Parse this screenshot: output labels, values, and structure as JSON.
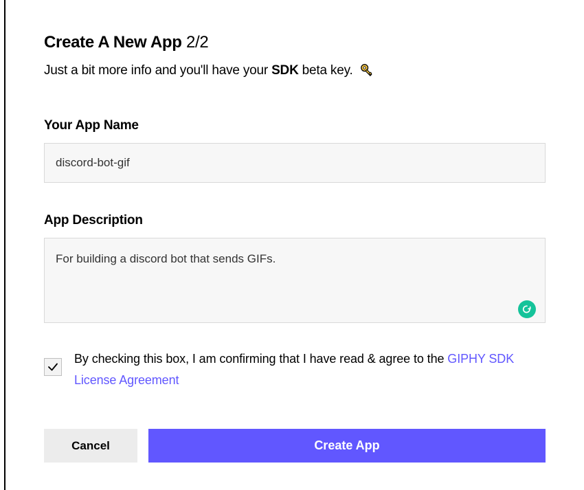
{
  "header": {
    "title_bold": "Create A New App",
    "step": "2/2",
    "subtitle_pre": "Just a bit more info and you'll have your ",
    "subtitle_bold": "SDK",
    "subtitle_post": " beta key."
  },
  "fields": {
    "app_name": {
      "label": "Your App Name",
      "value": "discord-bot-gif"
    },
    "app_description": {
      "label": "App Description",
      "value": "For building a discord bot that sends GIFs."
    }
  },
  "consent": {
    "checked": true,
    "text": "By checking this box, I am confirming that I have read & agree to the ",
    "link_text": "GIPHY SDK License Agreement"
  },
  "buttons": {
    "cancel": "Cancel",
    "create": "Create App"
  },
  "icons": {
    "key": "key-icon",
    "grammarly": "grammarly-icon",
    "check": "check-icon"
  }
}
